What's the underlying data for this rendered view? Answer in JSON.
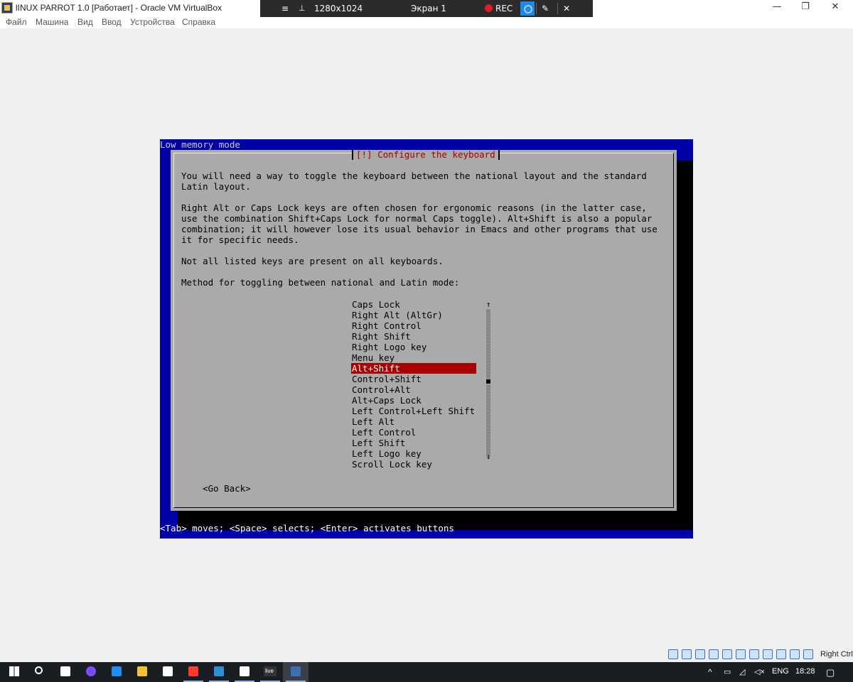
{
  "window": {
    "title": "lINUX PARROT 1.0 [Работает] - Oracle VM VirtualBox",
    "controls": {
      "minimize": "—",
      "maximize": "❐",
      "close": "✕"
    }
  },
  "menu": [
    "Файл",
    "Машина",
    "Вид",
    "Ввод",
    "Устройства",
    "Справка"
  ],
  "mini_toolbar": {
    "menu_icon": "≡",
    "pin_icon": "📌",
    "resolution": "1280x1024",
    "screen": "Экран 1",
    "rec_label": "REC",
    "edit_icon": "✎",
    "close_icon": "✕"
  },
  "console": {
    "top_label": "Low memory mode",
    "dialog_title": "[!] Configure the keyboard",
    "paragraphs": [
      "You will need a way to toggle the keyboard between the national layout and the standard\nLatin layout.",
      "Right Alt or Caps Lock keys are often chosen for ergonomic reasons (in the latter case,\nuse the combination Shift+Caps Lock for normal Caps toggle). Alt+Shift is also a popular\ncombination; it will however lose its usual behavior in Emacs and other programs that use\nit for specific needs.",
      "Not all listed keys are present on all keyboards.",
      "Method for toggling between national and Latin mode:"
    ],
    "options": [
      "Caps Lock",
      "Right Alt (AltGr)",
      "Right Control",
      "Right Shift",
      "Right Logo key",
      "Menu key",
      "Alt+Shift",
      "Control+Shift",
      "Control+Alt",
      "Alt+Caps Lock",
      "Left Control+Left Shift",
      "Left Alt",
      "Left Control",
      "Left Shift",
      "Left Logo key",
      "Scroll Lock key"
    ],
    "selected_index": 6,
    "scroll_position": 0.5,
    "scroll_up": "↑",
    "scroll_down": "↓",
    "go_back": "<Go Back>",
    "help": "<Tab> moves; <Space> selects; <Enter> activates buttons"
  },
  "vbox_status": {
    "icons": [
      "hdd-icon",
      "optical-icon",
      "audio-icon",
      "network-icon",
      "usb-icon",
      "shared-folders-icon",
      "display-icon",
      "video-capture-icon",
      "cpu-icon",
      "mouse-integration-icon",
      "arrow-icon"
    ],
    "host_key": "Right Ctrl"
  },
  "taskbar": {
    "icons": [
      "windows-start-icon",
      "search-icon",
      "task-view-icon",
      "alice-icon",
      "edge-icon",
      "file-explorer-icon",
      "store-icon",
      "yandex-browser-icon",
      "contacts-icon",
      "mail-icon",
      "live-icon",
      "virtualbox-icon"
    ],
    "live_label": "live",
    "tray": {
      "chevron": "^",
      "lang": "ENG",
      "time": "18:28"
    }
  },
  "colors": {
    "console_blue": "#0000a8",
    "dialog_gray": "#aaaaaa",
    "title_red": "#a80000",
    "selection_red": "#a80000",
    "taskbar": "#1a1d22"
  }
}
